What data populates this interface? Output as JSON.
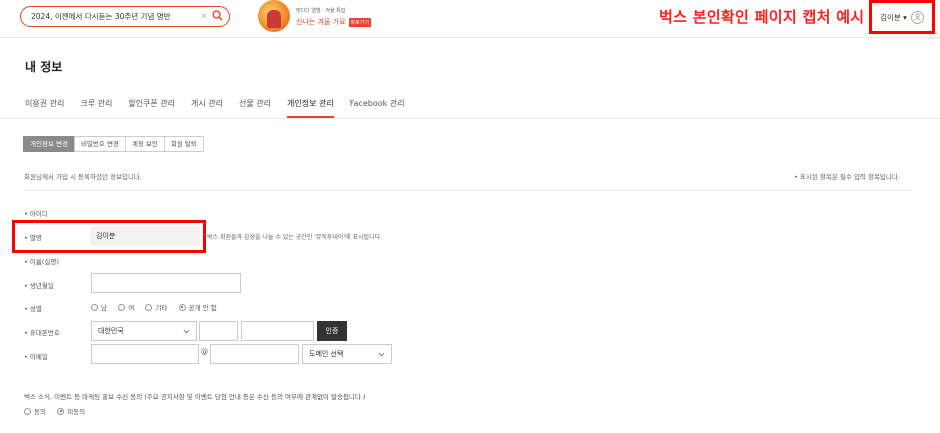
{
  "header": {
    "search_query": "2024, 이젠에서 다시듣는 30주년 기념 명반",
    "clear_icon": "close-icon",
    "search_icon": "search-icon",
    "promo_small": "맞디다 앨범 · 겨울 특집",
    "promo_main": "신나는 겨울 가요",
    "promo_tag": "바로가기",
    "caption": "벅스 본인확인 페이지 캡처 예시",
    "user_name": "김이분",
    "user_caret": "▾",
    "accent_color": "#e8412c",
    "highlight_color": "#ff0000"
  },
  "page": {
    "title": "내 정보",
    "tabs": [
      {
        "label": "이용권 관리"
      },
      {
        "label": "크루 관리"
      },
      {
        "label": "할인쿠폰 관리"
      },
      {
        "label": "게시 관리"
      },
      {
        "label": "선물 관리"
      },
      {
        "label": "개인정보 관리"
      },
      {
        "label": "Facebook 관리"
      }
    ],
    "active_tab": "개인정보 관리",
    "subtabs": [
      {
        "label": "개인정보 변경"
      },
      {
        "label": "비밀번호 변경"
      },
      {
        "label": "계정 보안"
      },
      {
        "label": "회원 탈퇴"
      }
    ],
    "intro": "회원님께서 가입 시 등록하셨던 정보입니다.",
    "required_note": "• 표시된 항목은 필수 입력 항목입니다."
  },
  "form": {
    "id_label": "• 아이디",
    "nick_label": "• 별명",
    "nick_value": "김이분",
    "nick_desc": "벅스 회원들과 감성을 나눌 수 있는 공간인 '뮤직투데이'에 표시됩니다.",
    "realname_label": "• 이름(실명)",
    "birth_label": "• 생년월일",
    "gender_label": "• 성별",
    "gender_options": [
      {
        "label": "남",
        "selected": false
      },
      {
        "label": "여",
        "selected": false
      },
      {
        "label": "기타",
        "selected": false
      },
      {
        "label": "공개 안 함",
        "selected": true
      }
    ],
    "phone_label": "• 휴대폰번호",
    "country_value": "대한민국",
    "auth_label": "인증",
    "email_label": "• 이메일",
    "at_sign": "@",
    "domain_placeholder": "도메인 선택",
    "marketing_text": "벅스 소식, 이벤트 등 마케팅 홍보 수신 동의 (주요 공지사항 및 이벤트 당첨 안내 등은 수신 동의 여부에 관계없이 발송됩니다.)",
    "agree_options": [
      {
        "label": "동의",
        "selected": false
      },
      {
        "label": "미동의",
        "selected": true
      }
    ]
  }
}
